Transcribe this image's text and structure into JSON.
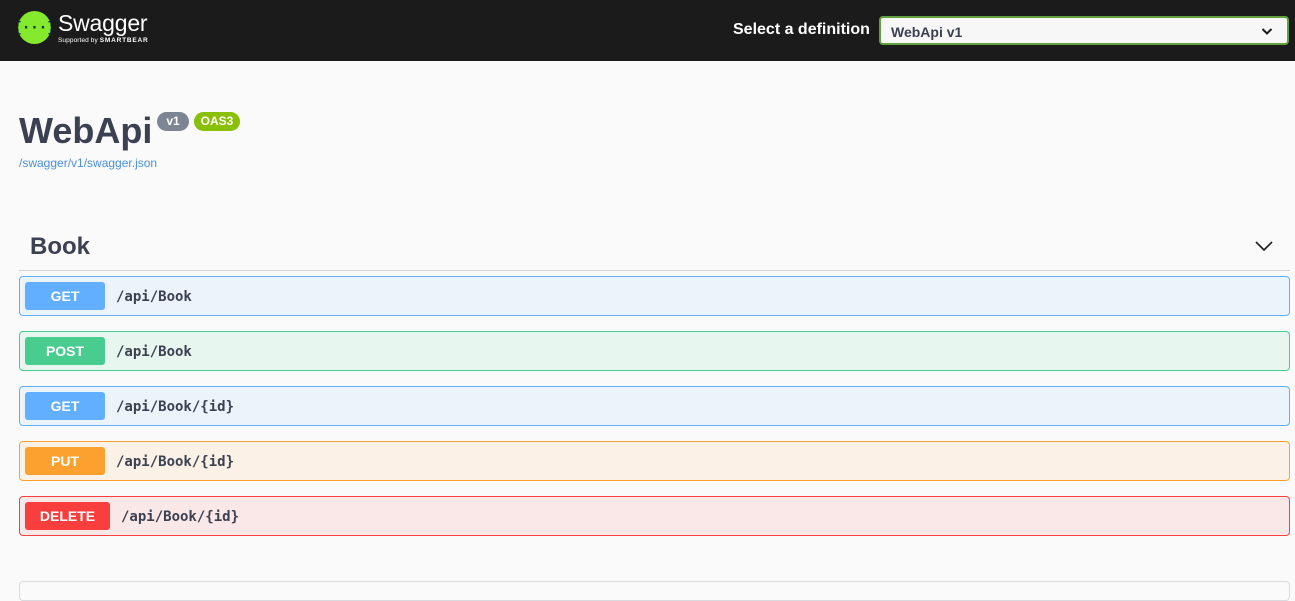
{
  "topbar": {
    "logo_name": "Swagger",
    "logo_sub_prefix": "Supported by",
    "logo_sub_brand": "SMARTBEAR",
    "definition_label": "Select a definition",
    "definition_selected": "WebApi v1"
  },
  "info": {
    "title": "WebApi",
    "version": "v1",
    "oas_badge": "OAS3",
    "spec_url": "/swagger/v1/swagger.json"
  },
  "tag": {
    "name": "Book"
  },
  "operations": [
    {
      "method": "GET",
      "path": "/api/Book"
    },
    {
      "method": "POST",
      "path": "/api/Book"
    },
    {
      "method": "GET",
      "path": "/api/Book/{id}"
    },
    {
      "method": "PUT",
      "path": "/api/Book/{id}"
    },
    {
      "method": "DELETE",
      "path": "/api/Book/{id}"
    }
  ],
  "colors": {
    "topbar": "#1b1b1b",
    "get": "#61affe",
    "post": "#49cc90",
    "put": "#fca130",
    "delete": "#f93e3e",
    "logo": "#85ea2d"
  }
}
